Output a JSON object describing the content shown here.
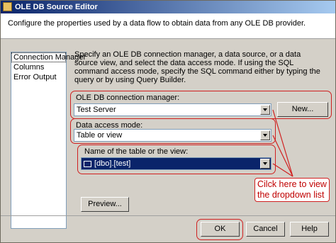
{
  "window": {
    "title": "OLE DB Source Editor"
  },
  "header": {
    "description": "Configure the properties used by a data flow to obtain data from any OLE DB provider."
  },
  "nav": {
    "items": [
      "Connection Manager",
      "Columns",
      "Error Output"
    ],
    "selected": "Connection Manager"
  },
  "main": {
    "description": "Specify an OLE DB connection manager, a data source, or a data source view, and select the data access mode. If using the SQL command access mode, specify the SQL command either by typing the query or by using Query Builder.",
    "connection_label": "OLE DB connection manager:",
    "connection_value": "Test Server",
    "new_button": "New...",
    "access_label": "Data access mode:",
    "access_value": "Table or view",
    "table_label": "Name of the table or the view:",
    "table_value": "[dbo].[test]",
    "preview_button": "Preview..."
  },
  "annotation": {
    "line1": "Cilck here to view",
    "line2": "the dropdown list"
  },
  "footer": {
    "ok": "OK",
    "cancel": "Cancel",
    "help": "Help"
  },
  "colors": {
    "highlight_ring": "#d02020",
    "annotation_text": "#c00000",
    "selection": "#0a246a"
  }
}
